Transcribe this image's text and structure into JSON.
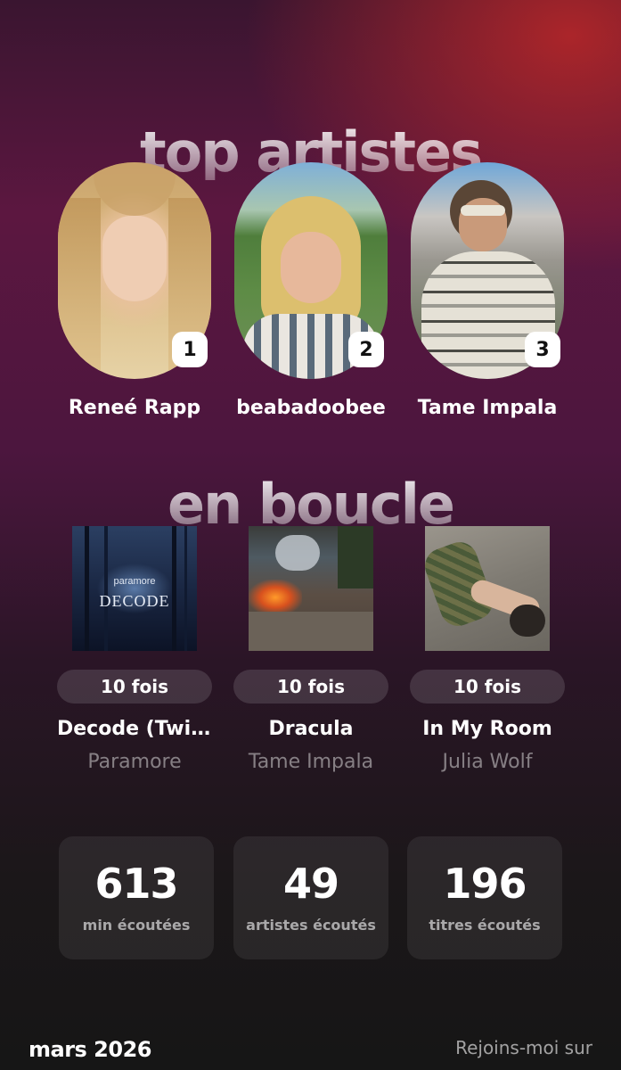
{
  "headings": {
    "top_artists": "top artistes",
    "on_repeat": "en boucle"
  },
  "artists": [
    {
      "rank": "1",
      "name": "Reneé Rapp"
    },
    {
      "rank": "2",
      "name": "beabadoobee"
    },
    {
      "rank": "3",
      "name": "Tame Impala"
    }
  ],
  "tracks": [
    {
      "plays": "10 fois",
      "title": "Decode (Twilight Version)",
      "artist": "Paramore",
      "cover_text_top": "paramore",
      "cover_text_main": "DECODE"
    },
    {
      "plays": "10 fois",
      "title": "Dracula",
      "artist": "Tame Impala"
    },
    {
      "plays": "10 fois",
      "title": "In My Room",
      "artist": "Julia Wolf"
    }
  ],
  "stats": [
    {
      "value": "613",
      "label": "min écoutées"
    },
    {
      "value": "49",
      "label": "artistes écoutés"
    },
    {
      "value": "196",
      "label": "titres écoutés"
    }
  ],
  "footer": {
    "date": "mars 2026",
    "cta": "Rejoins-moi sur"
  },
  "colors": {
    "accent_red": "#be2828",
    "background_dark": "#161616",
    "background_plum": "#5c1740"
  }
}
